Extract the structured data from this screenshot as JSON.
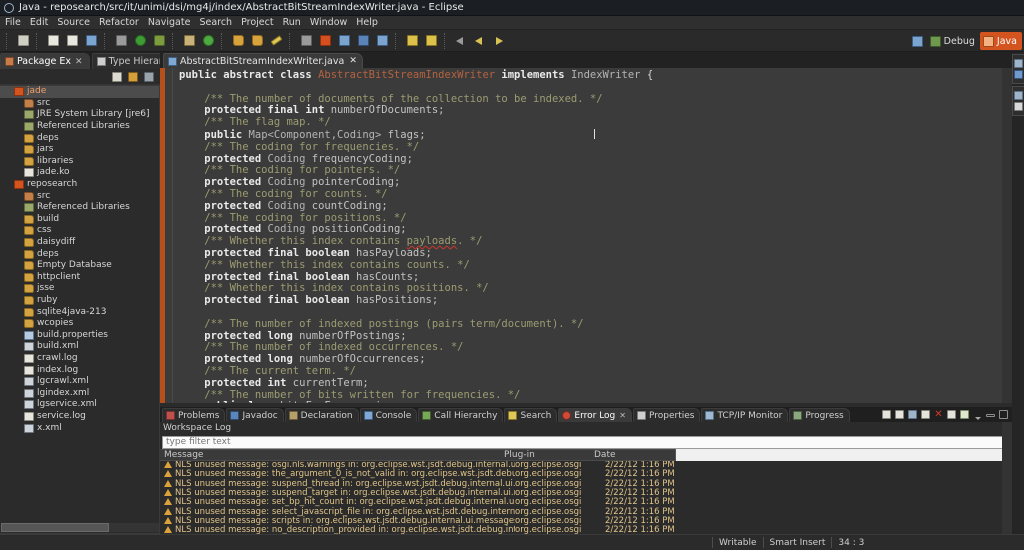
{
  "window": {
    "title": "Java - reposearch/src/it/unimi/dsi/mg4j/index/AbstractBitStreamIndexWriter.java - Eclipse",
    "icon": "eclipse-icon"
  },
  "menubar": {
    "items": [
      "File",
      "Edit",
      "Source",
      "Refactor",
      "Navigate",
      "Search",
      "Project",
      "Run",
      "Window",
      "Help"
    ]
  },
  "toolbar": {
    "groups": [
      {
        "buttons": [
          {
            "name": "new-wizard-button",
            "glyph": "sq"
          }
        ]
      },
      {
        "buttons": [
          {
            "name": "save-button",
            "glyph": "page"
          },
          {
            "name": "save-all-button",
            "glyph": "page"
          },
          {
            "name": "print-button",
            "glyph": "blu2"
          }
        ]
      },
      {
        "buttons": [
          {
            "name": "skip-breakpoints-button",
            "glyph": "gry"
          },
          {
            "name": "run-button",
            "glyph": "grn"
          },
          {
            "name": "debug-button",
            "glyph": "bug"
          }
        ]
      },
      {
        "buttons": [
          {
            "name": "new-java-project-button",
            "glyph": "box"
          },
          {
            "name": "new-java-class-button",
            "glyph": "grn2"
          }
        ]
      },
      {
        "buttons": [
          {
            "name": "open-type-button",
            "glyph": "fold"
          },
          {
            "name": "open-task-button",
            "glyph": "fold"
          },
          {
            "name": "edit-button",
            "glyph": "pen"
          }
        ]
      },
      {
        "buttons": [
          {
            "name": "search-button",
            "glyph": "gry"
          },
          {
            "name": "stop-button",
            "glyph": "red"
          },
          {
            "name": "next-annotation-button",
            "glyph": "blu2"
          },
          {
            "name": "previous-annotation-button",
            "glyph": "blu"
          },
          {
            "name": "toggle-mark-occurrences-button",
            "glyph": "blu2"
          }
        ]
      },
      {
        "buttons": [
          {
            "name": "last-edit-location-button",
            "glyph": "yel"
          },
          {
            "name": "next-edit-button",
            "glyph": "yel"
          }
        ]
      },
      {
        "buttons": [
          {
            "name": "back-arrow-button",
            "glyph": "arrowL-gray"
          },
          {
            "name": "back-button",
            "glyph": "arrowL"
          },
          {
            "name": "forward-button",
            "glyph": "arrowR"
          }
        ]
      }
    ],
    "perspective": {
      "open_label": "",
      "debug_label": "Debug",
      "java_label": "Java",
      "active": "Java",
      "accent_color": "#d4541f"
    }
  },
  "package_explorer": {
    "tabs": [
      {
        "label": "Package Ex",
        "icon": "package-explorer-icon",
        "active": true,
        "close": "✕"
      },
      {
        "label": "Type Hierar",
        "icon": "type-hierarchy-icon",
        "active": false
      }
    ],
    "view_buttons": [
      {
        "name": "collapse-all-button",
        "glyph": "w"
      },
      {
        "name": "link-with-editor-button",
        "glyph": "o"
      },
      {
        "name": "view-menu-button",
        "glyph": "s"
      }
    ],
    "tree": [
      {
        "label": "jade",
        "icon": "project",
        "indent": 1,
        "selected": true
      },
      {
        "label": "src",
        "icon": "srcfolder",
        "indent": 2
      },
      {
        "label": "JRE System Library [jre6]",
        "icon": "lib",
        "indent": 2
      },
      {
        "label": "Referenced Libraries",
        "icon": "lib",
        "indent": 2
      },
      {
        "label": "deps",
        "icon": "folder",
        "indent": 2
      },
      {
        "label": "jars",
        "icon": "folder",
        "indent": 2
      },
      {
        "label": "libraries",
        "icon": "folder",
        "indent": 2
      },
      {
        "label": "jade.ko",
        "icon": "file",
        "indent": 2
      },
      {
        "label": "reposearch",
        "icon": "project",
        "indent": 1
      },
      {
        "label": "src",
        "icon": "srcfolder",
        "indent": 2
      },
      {
        "label": "Referenced Libraries",
        "icon": "lib",
        "indent": 2
      },
      {
        "label": "build",
        "icon": "folder",
        "indent": 2
      },
      {
        "label": "css",
        "icon": "folder",
        "indent": 2
      },
      {
        "label": "daisydiff",
        "icon": "folder",
        "indent": 2
      },
      {
        "label": "deps",
        "icon": "folder",
        "indent": 2
      },
      {
        "label": "Empty Database",
        "icon": "folder",
        "indent": 2
      },
      {
        "label": "httpclient",
        "icon": "folder",
        "indent": 2
      },
      {
        "label": "jsse",
        "icon": "folder",
        "indent": 2
      },
      {
        "label": "ruby",
        "icon": "folder",
        "indent": 2
      },
      {
        "label": "sqlite4java-213",
        "icon": "folder",
        "indent": 2
      },
      {
        "label": "wcopies",
        "icon": "folder",
        "indent": 2
      },
      {
        "label": "build.properties",
        "icon": "props",
        "indent": 2
      },
      {
        "label": "build.xml",
        "icon": "xml",
        "indent": 2
      },
      {
        "label": "crawl.log",
        "icon": "file",
        "indent": 2
      },
      {
        "label": "index.log",
        "icon": "file",
        "indent": 2
      },
      {
        "label": "lgcrawl.xml",
        "icon": "xml",
        "indent": 2
      },
      {
        "label": "lgindex.xml",
        "icon": "xml",
        "indent": 2
      },
      {
        "label": "lgservice.xml",
        "icon": "xml",
        "indent": 2
      },
      {
        "label": "service.log",
        "icon": "file",
        "indent": 2
      },
      {
        "label": "x.xml",
        "icon": "xml",
        "indent": 2
      }
    ]
  },
  "editor": {
    "tab": {
      "label": "AbstractBitStreamIndexWriter.java",
      "icon": "java-file-icon",
      "close": "✕"
    },
    "lines": [
      [
        {
          "t": "public abstract class ",
          "c": "k"
        },
        {
          "t": "AbstractBitStreamIndexWriter ",
          "c": "cls"
        },
        {
          "t": "implements ",
          "c": "k"
        },
        {
          "t": "IndexWriter ",
          "c": "ty"
        },
        {
          "t": "{",
          "c": "pl"
        }
      ],
      [],
      [
        {
          "t": "    /** The number of documents of the collection to be indexed. */",
          "c": "cm"
        }
      ],
      [
        {
          "t": "    protected final int ",
          "c": "k"
        },
        {
          "t": "numberOfDocuments;",
          "c": "id"
        }
      ],
      [
        {
          "t": "    /** The flag map. */",
          "c": "cm"
        }
      ],
      [
        {
          "t": "    public ",
          "c": "k"
        },
        {
          "t": "Map<Component,Coding> ",
          "c": "ty"
        },
        {
          "t": "flags;",
          "c": "id"
        }
      ],
      [
        {
          "t": "    /** The coding for frequencies. */",
          "c": "cm"
        }
      ],
      [
        {
          "t": "    protected ",
          "c": "k"
        },
        {
          "t": "Coding ",
          "c": "ty"
        },
        {
          "t": "frequencyCoding;",
          "c": "id"
        }
      ],
      [
        {
          "t": "    /** The coding for pointers. */",
          "c": "cm"
        }
      ],
      [
        {
          "t": "    protected ",
          "c": "k"
        },
        {
          "t": "Coding ",
          "c": "ty"
        },
        {
          "t": "pointerCoding;",
          "c": "id"
        }
      ],
      [
        {
          "t": "    /** The coding for counts. */",
          "c": "cm"
        }
      ],
      [
        {
          "t": "    protected ",
          "c": "k"
        },
        {
          "t": "Coding ",
          "c": "ty"
        },
        {
          "t": "countCoding;",
          "c": "id"
        }
      ],
      [
        {
          "t": "    /** The coding for positions. */",
          "c": "cm"
        }
      ],
      [
        {
          "t": "    protected ",
          "c": "k"
        },
        {
          "t": "Coding ",
          "c": "ty"
        },
        {
          "t": "positionCoding;",
          "c": "id"
        }
      ],
      [
        {
          "t": "    /** Whether this index contains ",
          "c": "cm"
        },
        {
          "t": "payloads",
          "c": "cm sp"
        },
        {
          "t": ". */",
          "c": "cm"
        }
      ],
      [
        {
          "t": "    protected final boolean ",
          "c": "k"
        },
        {
          "t": "hasPayloads;",
          "c": "id"
        }
      ],
      [
        {
          "t": "    /** Whether this index contains counts. */",
          "c": "cm"
        }
      ],
      [
        {
          "t": "    protected final boolean ",
          "c": "k"
        },
        {
          "t": "hasCounts;",
          "c": "id"
        }
      ],
      [
        {
          "t": "    /** Whether this index contains positions. */",
          "c": "cm"
        }
      ],
      [
        {
          "t": "    protected final boolean ",
          "c": "k"
        },
        {
          "t": "hasPositions;",
          "c": "id"
        }
      ],
      [],
      [
        {
          "t": "    /** The number of indexed postings (pairs term/document). */",
          "c": "cm"
        }
      ],
      [
        {
          "t": "    protected long ",
          "c": "k"
        },
        {
          "t": "numberOfPostings;",
          "c": "id"
        }
      ],
      [
        {
          "t": "    /** The number of indexed occurrences. */",
          "c": "cm"
        }
      ],
      [
        {
          "t": "    protected long ",
          "c": "k"
        },
        {
          "t": "numberOfOccurrences;",
          "c": "id"
        }
      ],
      [
        {
          "t": "    /** The current term. */",
          "c": "cm"
        }
      ],
      [
        {
          "t": "    protected int ",
          "c": "k"
        },
        {
          "t": "currentTerm;",
          "c": "id"
        }
      ],
      [
        {
          "t": "    /** The number of bits written for frequencies. */",
          "c": "cm"
        }
      ],
      [
        {
          "t": "    public long ",
          "c": "k"
        },
        {
          "t": "bitsForFrequencies;",
          "c": "id"
        }
      ]
    ]
  },
  "bottom_panel": {
    "tabs": [
      {
        "label": "Problems",
        "icon": "problems",
        "active": false
      },
      {
        "label": "Javadoc",
        "icon": "javadoc",
        "active": false
      },
      {
        "label": "Declaration",
        "icon": "decl",
        "active": false
      },
      {
        "label": "Console",
        "icon": "console",
        "active": false
      },
      {
        "label": "Call Hierarchy",
        "icon": "callh",
        "active": false
      },
      {
        "label": "Search",
        "icon": "search",
        "active": false
      },
      {
        "label": "Error Log",
        "icon": "errorlog",
        "active": true,
        "close": "✕"
      },
      {
        "label": "Properties",
        "icon": "props",
        "active": false
      },
      {
        "label": "TCP/IP Monitor",
        "icon": "tcp",
        "active": false
      },
      {
        "label": "Progress",
        "icon": "progress",
        "active": false
      }
    ],
    "toolbar_buttons": [
      {
        "name": "export-log-button",
        "glyph": "page"
      },
      {
        "name": "import-log-button",
        "glyph": "page"
      },
      {
        "name": "restore-log-button",
        "glyph": "sav"
      },
      {
        "name": "open-log-button",
        "glyph": "page"
      },
      {
        "name": "delete-log-button",
        "glyph": "red",
        "label": "✕"
      },
      {
        "name": "new-log-button",
        "glyph": "page"
      },
      {
        "name": "activate-log-button",
        "glyph": "grn"
      },
      {
        "name": "view-menu-button",
        "glyph": "caret"
      },
      {
        "name": "minimize-button",
        "glyph": "min"
      },
      {
        "name": "maximize-button",
        "glyph": "max"
      }
    ],
    "panel_title": "Workspace Log",
    "filter": {
      "placeholder": "type filter text",
      "value": ""
    },
    "columns": [
      "Message",
      "Plug-in",
      "Date"
    ],
    "rows": [
      {
        "severity": "warning",
        "message": "NLS unused message: osgi.nls.warnings in: org.eclipse.wst.jsdt.debug.internal.ui.message",
        "plugin": "org.eclipse.osgi",
        "date": "2/22/12 1:16 PM"
      },
      {
        "severity": "warning",
        "message": "NLS unused message: the_argument_0_is_not_valid in: org.eclipse.wst.jsdt.debug.internal",
        "plugin": "org.eclipse.osgi",
        "date": "2/22/12 1:16 PM"
      },
      {
        "severity": "warning",
        "message": "NLS unused message: suspend_thread in: org.eclipse.wst.jsdt.debug.internal.ui.messages",
        "plugin": "org.eclipse.osgi",
        "date": "2/22/12 1:16 PM"
      },
      {
        "severity": "warning",
        "message": "NLS unused message: suspend_target in: org.eclipse.wst.jsdt.debug.internal.ui.messages",
        "plugin": "org.eclipse.osgi",
        "date": "2/22/12 1:16 PM"
      },
      {
        "severity": "warning",
        "message": "NLS unused message: set_bp_hit_count in: org.eclipse.wst.jsdt.debug.internal.ui.message",
        "plugin": "org.eclipse.osgi",
        "date": "2/22/12 1:16 PM"
      },
      {
        "severity": "warning",
        "message": "NLS unused message: select_javascript_file in: org.eclipse.wst.jsdt.debug.internal.ui.mess",
        "plugin": "org.eclipse.osgi",
        "date": "2/22/12 1:16 PM"
      },
      {
        "severity": "warning",
        "message": "NLS unused message: scripts in: org.eclipse.wst.jsdt.debug.internal.ui.messages",
        "plugin": "org.eclipse.osgi",
        "date": "2/22/12 1:16 PM"
      },
      {
        "severity": "warning",
        "message": "NLS unused message: no_description_provided in: org.eclipse.wst.jsdt.debug.internal.ui.n",
        "plugin": "org.eclipse.osgi",
        "date": "2/22/12 1:16 PM"
      }
    ]
  },
  "status_bar": {
    "writable": "Writable",
    "insert_mode": "Smart Insert",
    "position": "34 : 3"
  }
}
